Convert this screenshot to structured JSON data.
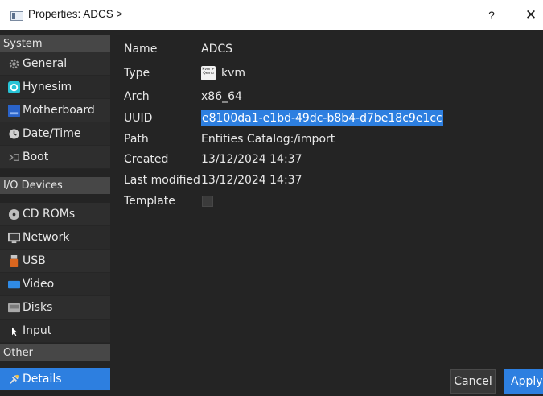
{
  "window": {
    "title": "Properties: ADCS >",
    "help_label": "?",
    "close_label": "✕"
  },
  "sidebar": {
    "sections": [
      {
        "header": "System",
        "items": [
          "General",
          "Hynesim",
          "Motherboard",
          "Date/Time",
          "Boot"
        ]
      },
      {
        "header": "I/O Devices",
        "items": [
          "CD ROMs",
          "Network",
          "USB",
          "Video",
          "Disks",
          "Input"
        ]
      },
      {
        "header": "Other",
        "items": [
          "Details"
        ]
      }
    ],
    "selected": "Details"
  },
  "details": {
    "name_label": "Name",
    "name_value": "ADCS",
    "type_label": "Type",
    "type_value": "kvm",
    "type_icon_text": "Kvm + Qemu",
    "arch_label": "Arch",
    "arch_value": "x86_64",
    "uuid_label": "UUID",
    "uuid_value": "e8100da1-e1bd-49dc-b8b4-d7be18c9e1cc",
    "path_label": "Path",
    "path_value": "Entities Catalog:/import",
    "created_label": "Created",
    "created_value": "13/12/2024 14:37",
    "modified_label": "Last modified",
    "modified_value": "13/12/2024 14:37",
    "template_label": "Template",
    "template_checked": false
  },
  "buttons": {
    "cancel_label": "Cancel",
    "apply_label": "Apply"
  },
  "colors": {
    "accent": "#2d7fe0",
    "background": "#242424",
    "sidebar_item": "#2e2e2e",
    "sidebar_header": "#474747"
  }
}
